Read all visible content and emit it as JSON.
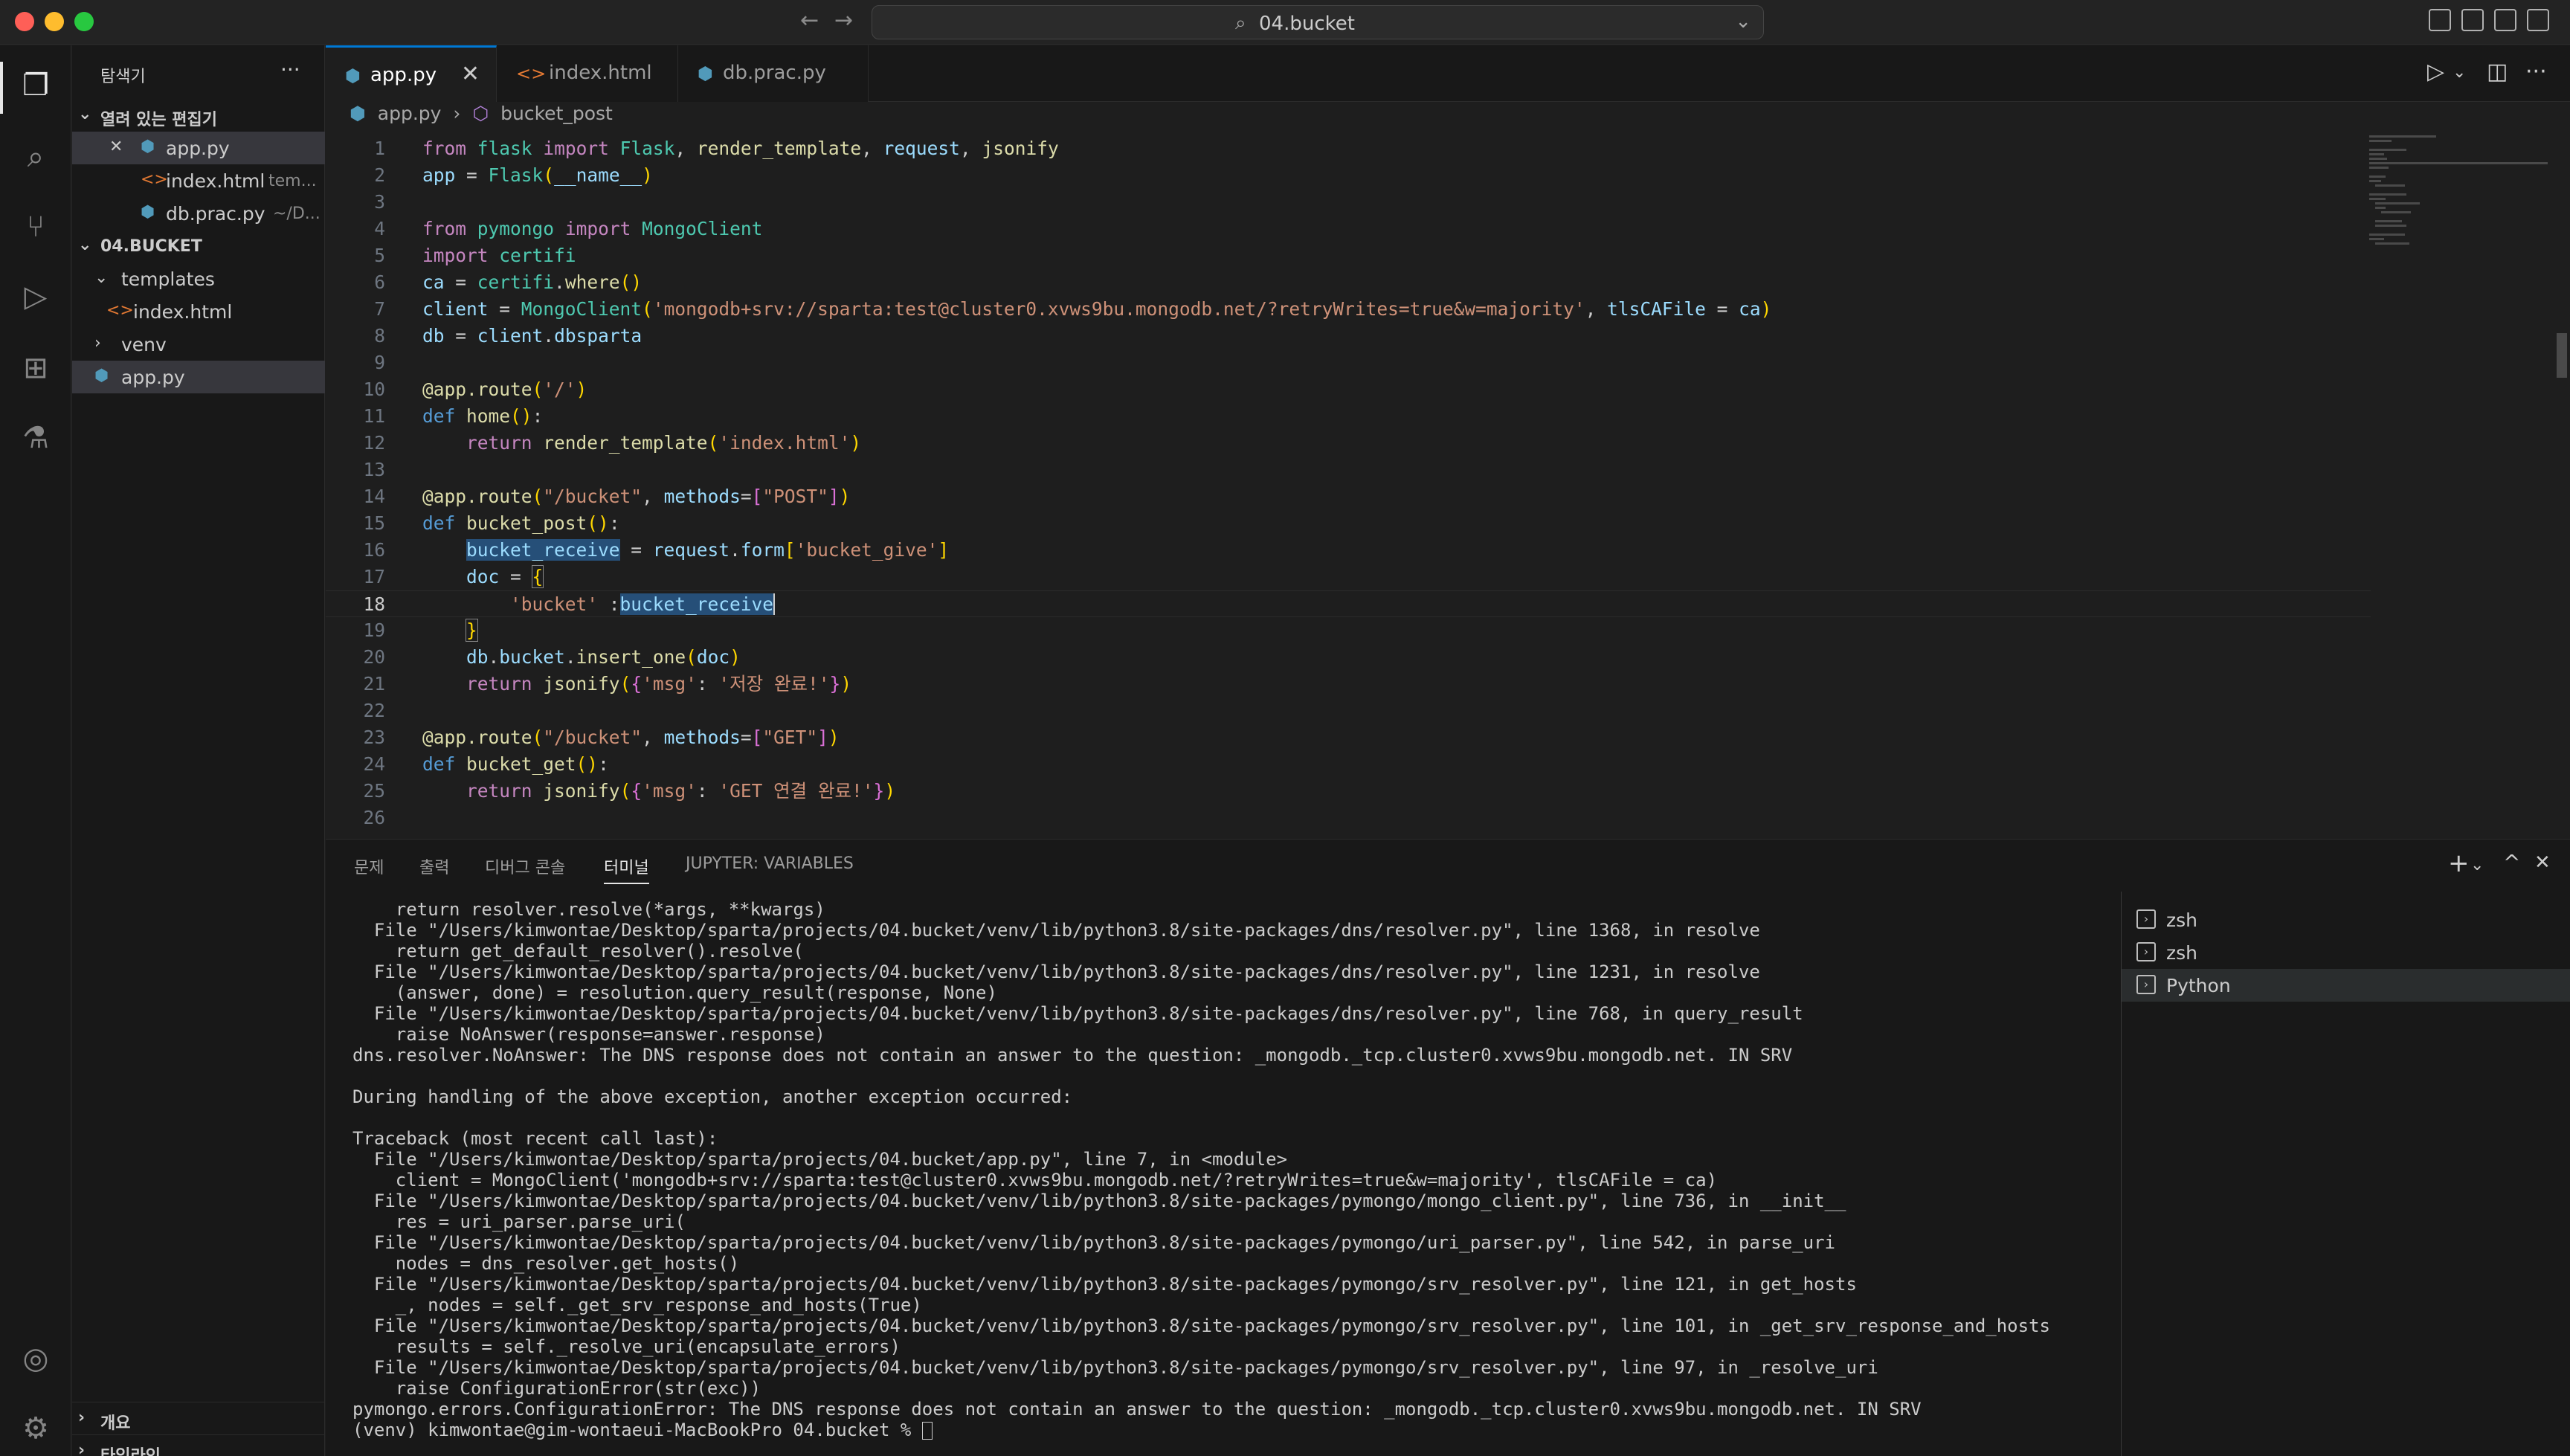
{
  "titlebar": {
    "search_label": "04.bucket",
    "back_icon": "arrow-left-icon",
    "forward_icon": "arrow-right-icon"
  },
  "activity": [
    "files-icon",
    "search-icon",
    "source-control-icon",
    "run-debug-icon",
    "extensions-icon",
    "testing-icon",
    "account-icon",
    "settings-gear-icon"
  ],
  "sidebar": {
    "title": "탐색기",
    "open_editors_label": "열려 있는 편집기",
    "open_editors": [
      {
        "name": "app.py",
        "desc": ""
      },
      {
        "name": "index.html",
        "desc": "tem..."
      },
      {
        "name": "db.prac.py",
        "desc": "~/D..."
      }
    ],
    "folder_label": "04.BUCKET",
    "tree": [
      {
        "name": "templates"
      },
      {
        "name": "index.html"
      },
      {
        "name": "venv"
      },
      {
        "name": "app.py"
      }
    ],
    "outline_label": "개요",
    "timeline_label": "타임라인"
  },
  "tabs": [
    {
      "name": "app.py"
    },
    {
      "name": "index.html"
    },
    {
      "name": "db.prac.py"
    }
  ],
  "breadcrumb": {
    "file": "app.py",
    "sep": "›",
    "symbol": "bucket_post"
  },
  "editor": {
    "current_line": 18,
    "line_numbers": [
      "1",
      "2",
      "3",
      "4",
      "5",
      "6",
      "7",
      "8",
      "9",
      "10",
      "11",
      "12",
      "13",
      "14",
      "15",
      "16",
      "17",
      "18",
      "19",
      "20",
      "21",
      "22",
      "23",
      "24",
      "25",
      "26"
    ]
  },
  "panel": {
    "tabs": [
      "문제",
      "출력",
      "디버그 콘솔",
      "터미널",
      "JUPYTER: VARIABLES"
    ],
    "active_tab": "터미널",
    "terminals": [
      "zsh",
      "zsh",
      "Python"
    ],
    "terminal_lines": [
      "    return resolver.resolve(*args, **kwargs)",
      "  File \"/Users/kimwontae/Desktop/sparta/projects/04.bucket/venv/lib/python3.8/site-packages/dns/resolver.py\", line 1368, in resolve",
      "    return get_default_resolver().resolve(",
      "  File \"/Users/kimwontae/Desktop/sparta/projects/04.bucket/venv/lib/python3.8/site-packages/dns/resolver.py\", line 1231, in resolve",
      "    (answer, done) = resolution.query_result(response, None)",
      "  File \"/Users/kimwontae/Desktop/sparta/projects/04.bucket/venv/lib/python3.8/site-packages/dns/resolver.py\", line 768, in query_result",
      "    raise NoAnswer(response=answer.response)",
      "dns.resolver.NoAnswer: The DNS response does not contain an answer to the question: _mongodb._tcp.cluster0.xvws9bu.mongodb.net. IN SRV",
      "",
      "During handling of the above exception, another exception occurred:",
      "",
      "Traceback (most recent call last):",
      "  File \"/Users/kimwontae/Desktop/sparta/projects/04.bucket/app.py\", line 7, in <module>",
      "    client = MongoClient('mongodb+srv://sparta:test@cluster0.xvws9bu.mongodb.net/?retryWrites=true&w=majority', tlsCAFile = ca)",
      "  File \"/Users/kimwontae/Desktop/sparta/projects/04.bucket/venv/lib/python3.8/site-packages/pymongo/mongo_client.py\", line 736, in __init__",
      "    res = uri_parser.parse_uri(",
      "  File \"/Users/kimwontae/Desktop/sparta/projects/04.bucket/venv/lib/python3.8/site-packages/pymongo/uri_parser.py\", line 542, in parse_uri",
      "    nodes = dns_resolver.get_hosts()",
      "  File \"/Users/kimwontae/Desktop/sparta/projects/04.bucket/venv/lib/python3.8/site-packages/pymongo/srv_resolver.py\", line 121, in get_hosts",
      "    _, nodes = self._get_srv_response_and_hosts(True)",
      "  File \"/Users/kimwontae/Desktop/sparta/projects/04.bucket/venv/lib/python3.8/site-packages/pymongo/srv_resolver.py\", line 101, in _get_srv_response_and_hosts",
      "    results = self._resolve_uri(encapsulate_errors)",
      "  File \"/Users/kimwontae/Desktop/sparta/projects/04.bucket/venv/lib/python3.8/site-packages/pymongo/srv_resolver.py\", line 97, in _resolve_uri",
      "    raise ConfigurationError(str(exc))",
      "pymongo.errors.ConfigurationError: The DNS response does not contain an answer to the question: _mongodb._tcp.cluster0.xvws9bu.mongodb.net. IN SRV"
    ],
    "prompt": "(venv) kimwontae@gim-wontaeui-MacBookPro 04.bucket % "
  },
  "colors": {
    "accent": "#0078d4",
    "editor_bg": "#1e1e1e",
    "chrome_bg": "#181818"
  }
}
